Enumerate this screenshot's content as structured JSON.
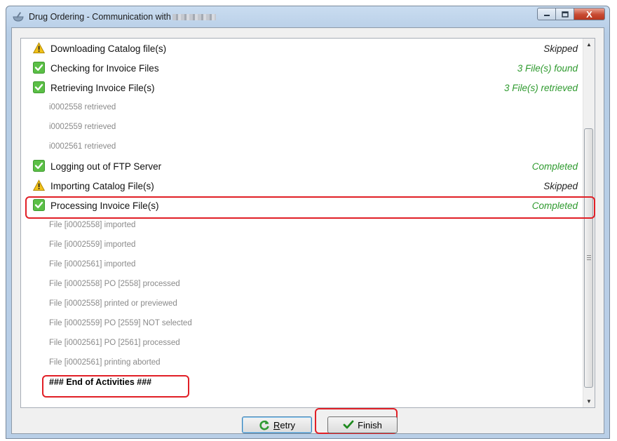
{
  "window": {
    "title": "Drug Ordering - Communication with",
    "controls": {
      "minimize": "minimize",
      "maximize": "maximize",
      "close": "X"
    }
  },
  "log": {
    "rows": [
      {
        "type": "main",
        "icon": "warning-icon",
        "label": "Downloading Catalog file(s)",
        "status": "Skipped",
        "status_color": "#222222"
      },
      {
        "type": "main",
        "icon": "check-icon",
        "label": "Checking for Invoice Files",
        "status": "3 File(s) found",
        "status_color": "#2e9a2e"
      },
      {
        "type": "main",
        "icon": "check-icon",
        "label": "Retrieving Invoice File(s)",
        "status": "3 File(s) retrieved",
        "status_color": "#2e9a2e"
      },
      {
        "type": "sub",
        "label": "i0002558 retrieved"
      },
      {
        "type": "sub",
        "label": "i0002559 retrieved"
      },
      {
        "type": "sub",
        "label": "i0002561 retrieved"
      },
      {
        "type": "main",
        "icon": "check-icon",
        "label": "Logging out of FTP Server",
        "status": "Completed",
        "status_color": "#2e9a2e"
      },
      {
        "type": "main",
        "icon": "warning-icon",
        "label": "Importing Catalog File(s)",
        "status": "Skipped",
        "status_color": "#222222"
      },
      {
        "type": "main",
        "icon": "check-icon",
        "label": "Processing Invoice File(s)",
        "status": "Completed",
        "status_color": "#2e9a2e"
      },
      {
        "type": "sub",
        "label": "File [i0002558] imported"
      },
      {
        "type": "sub",
        "label": "File [i0002559] imported"
      },
      {
        "type": "sub",
        "label": "File [i0002561] imported"
      },
      {
        "type": "sub",
        "label": "File [i0002558] PO [2558] processed"
      },
      {
        "type": "sub",
        "label": "File [i0002558] printed or previewed"
      },
      {
        "type": "sub",
        "label": "File [i0002559] PO [2559] NOT selected"
      },
      {
        "type": "sub",
        "label": "File [i0002561] PO [2561] processed"
      },
      {
        "type": "sub",
        "label": "File [i0002561] printing aborted"
      },
      {
        "type": "end",
        "label": "###  End of Activities  ###"
      }
    ]
  },
  "buttons": {
    "retry": {
      "accel": "R",
      "rest": "etry",
      "icon": "refresh-icon"
    },
    "finish": {
      "label": "Finish",
      "icon": "checkmark-icon"
    }
  },
  "colors": {
    "highlight": "#e11f26",
    "success": "#2e9a2e",
    "warning": "#f2c21b"
  }
}
